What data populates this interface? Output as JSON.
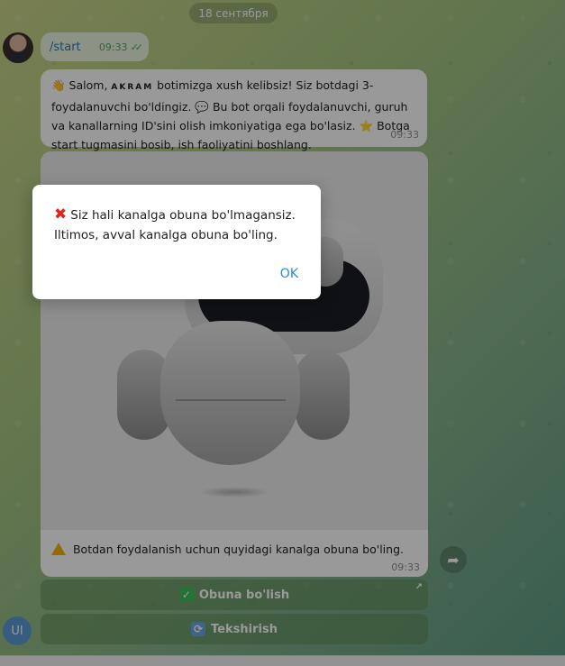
{
  "date_label": "18 сентября",
  "outgoing": {
    "command": "/start",
    "time": "09:33"
  },
  "welcome": {
    "emoji_wave": "👋",
    "part1": " Salom, ",
    "name": "AKRAM",
    "part2": " botimizga xush kelibsiz! Siz botdagi 3-foydalanuvchi bo'ldingiz. ",
    "emoji_speech": "💬",
    "part3": " Bu bot orqali foydalanuvchi, guruh va kanallarning ID'sini olish imkoniyatiga ega bo'lasiz. ",
    "emoji_star": "⭐",
    "part4": " Botga start tugmasini bosib, ish faoliyatini boshlang.",
    "time": "09:33"
  },
  "photo_message": {
    "caption": "Botdan foydalanish uchun quyidagi kanalga obuna bo'ling.",
    "time": "09:33"
  },
  "buttons": {
    "subscribe": "Obuna bo'lish",
    "check": "Tekshirish"
  },
  "dialog": {
    "line1": "Siz hali kanalga obuna bo'lmagansiz.",
    "line2": "Iltimos, avval kanalga obuna bo'ling.",
    "ok": "OK"
  },
  "user_avatar_initials": "UI",
  "icons": {
    "warning": "warning-icon",
    "check": "green-check-icon",
    "refresh": "refresh-icon",
    "share": "share-icon",
    "close": "red-x-icon"
  },
  "colors": {
    "link": "#2b8bd6",
    "error": "#e0241b",
    "outgoing_bubble": "#e9f6df"
  }
}
